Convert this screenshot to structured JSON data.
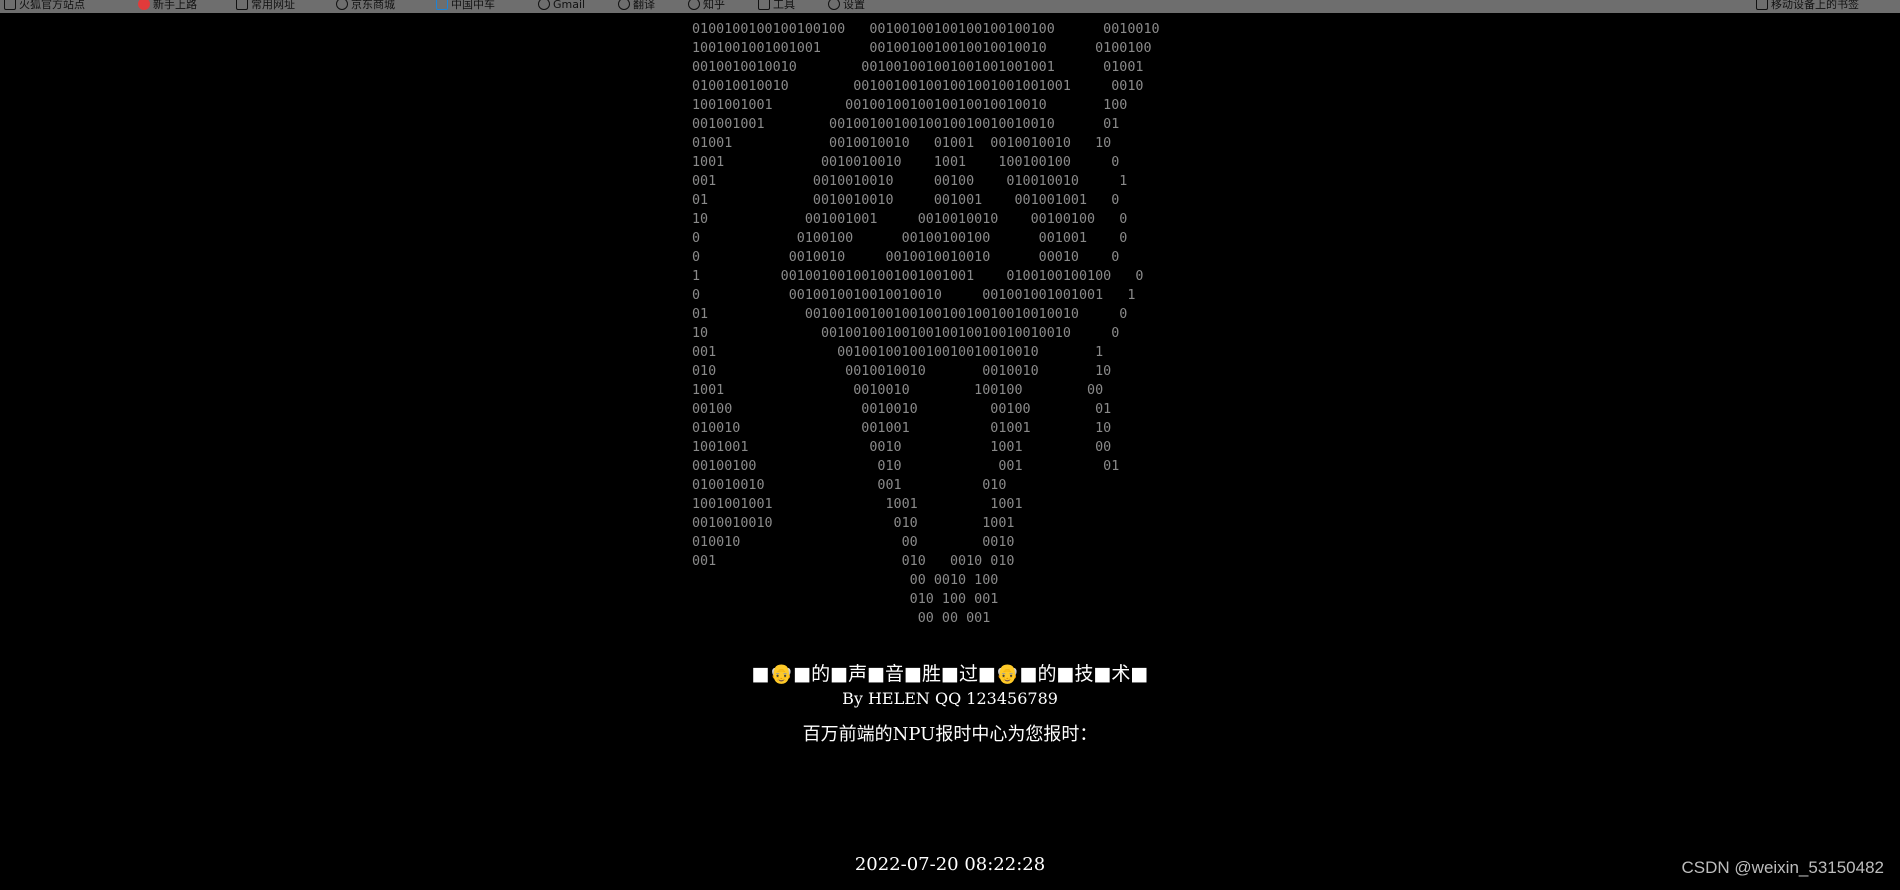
{
  "bookmarks": [
    {
      "label": "火狐官方站点",
      "icon": "page-icon"
    },
    {
      "label": "新手上路",
      "icon": "firefox-icon"
    },
    {
      "label": "常用网址",
      "icon": "folder-icon"
    },
    {
      "label": "京东商城",
      "icon": "globe-icon"
    },
    {
      "label": "中国中车",
      "icon": "app-icon"
    },
    {
      "label": "Gmail",
      "icon": "globe-icon"
    },
    {
      "label": "翻译",
      "icon": "globe-icon"
    },
    {
      "label": "知乎",
      "icon": "globe-icon"
    },
    {
      "label": "工具",
      "icon": "folder-icon"
    },
    {
      "label": "设置",
      "icon": "gear-icon"
    }
  ],
  "bookmarks_right": {
    "label": "移动设备上的书签",
    "icon": "mobile-icon"
  },
  "art_lines": [
    "0100100100100100100   00100100100100100100100      0010010",
    "1001001001001001      0010010010010010010010      0100100",
    "0010010010010        001001001001001001001001      01001",
    "010010010010        001001001001001001001001001     0010",
    "1001001001         0010010010010010010010010       100",
    "001001001        0010010010010010010010010010      01",
    "01001            0010010010   01001  0010010010   10",
    "1001            0010010010    1001    100100100     0",
    "001            0010010010     00100    010010010     1",
    "01             0010010010     001001    001001001   0",
    "10            001001001     0010010010    00100100   0",
    "0            0100100      00100100100      001001    0",
    "0           0010010     0010010010010      00010    0",
    "1          001001001001001001001001    0100100100100   0",
    "0           0010010010010010010     001001001001001   1",
    "01            0010010010010010010010010010010010     0",
    "10              0010010010010010010010010010010     0",
    "001               0010010010010010010010010       1",
    "010                0010010010       0010010       10",
    "1001                0010010        100100        00",
    "00100                0010010         00100        01",
    "010010               001001          01001        10",
    "1001001               0010           1001         00",
    "00100100               010            001          01",
    "010010010              001          010",
    "1001001001              1001         1001",
    "0010010010               010        1001",
    "010010                    00        0010",
    "001                       010   0010 010",
    "                           00 0010 100",
    "                           010 100 001",
    "                            00 00 001"
  ],
  "title_text": "■👴■的■声■音■胜■过■👴■的■技■术■",
  "byline": "By HELEN QQ 123456789",
  "report_text": "百万前端的NPU报时中心为您报时：",
  "clock": "2022-07-20 08:22:28",
  "watermark": "CSDN @weixin_53150482"
}
